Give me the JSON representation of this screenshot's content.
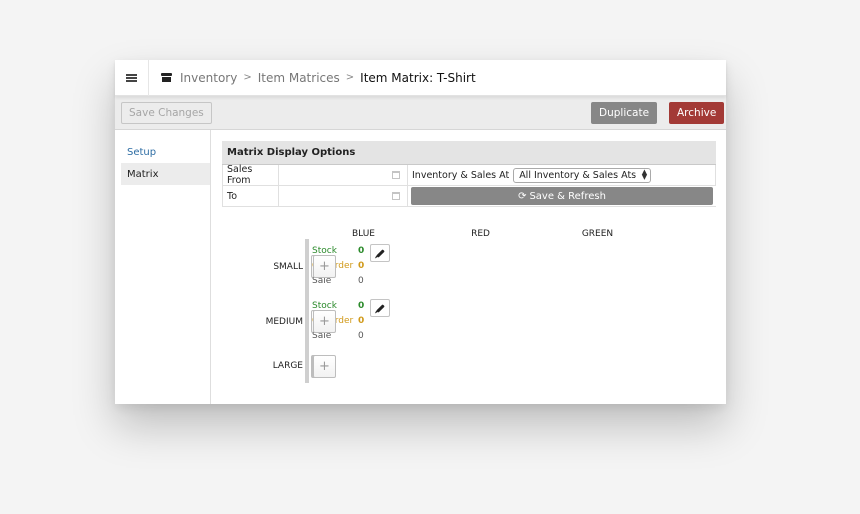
{
  "header": {
    "breadcrumb": [
      {
        "label": "Inventory"
      },
      {
        "label": "Item Matrices"
      }
    ],
    "separator": ">",
    "current": "Item Matrix: T-Shirt"
  },
  "toolbar": {
    "save_label": "Save Changes",
    "duplicate_label": "Duplicate",
    "archive_label": "Archive"
  },
  "sidebar": {
    "items": [
      {
        "label": "Setup"
      },
      {
        "label": "Matrix"
      }
    ]
  },
  "options": {
    "title": "Matrix Display Options",
    "sales_from_label": "Sales From",
    "sales_from_value": "",
    "to_label": "To",
    "to_value": "",
    "inventory_label": "Inventory & Sales At",
    "inventory_select": "All Inventory & Sales Ats",
    "refresh_label": "Save & Refresh"
  },
  "matrix": {
    "columns": [
      "BLUE",
      "RED",
      "GREEN"
    ],
    "rows": [
      "SMALL",
      "MEDIUM",
      "LARGE"
    ],
    "stat_labels": {
      "stock": "Stock",
      "on_order": "On Order",
      "sale": "Sale"
    },
    "cells": {
      "small_red": {
        "stock": "0",
        "on_order": "0",
        "sale": "0"
      },
      "medium_red": {
        "stock": "0",
        "on_order": "0",
        "sale": "0"
      }
    },
    "add_label": "+"
  }
}
